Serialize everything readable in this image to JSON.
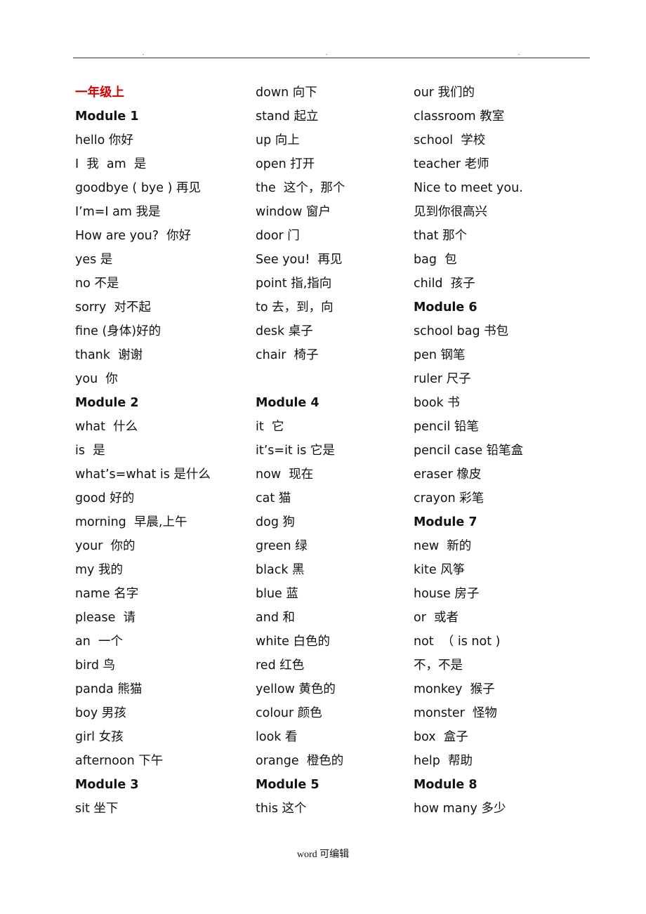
{
  "header": {
    "dots": [
      ".",
      ".",
      "."
    ]
  },
  "columns": [
    {
      "rows": [
        {
          "type": "title",
          "text": "一年级上"
        },
        {
          "type": "heading",
          "text": "Module 1"
        },
        {
          "type": "entry",
          "text": "hello 你好"
        },
        {
          "type": "entry",
          "text": "I  我  am  是"
        },
        {
          "type": "entry",
          "text": "goodbye ( bye ) 再见"
        },
        {
          "type": "entry",
          "text": "I’m=I am 我是"
        },
        {
          "type": "entry",
          "text": "How are you?  你好"
        },
        {
          "type": "entry",
          "text": "yes 是"
        },
        {
          "type": "entry",
          "text": "no 不是"
        },
        {
          "type": "entry",
          "text": "sorry  对不起"
        },
        {
          "type": "entry",
          "text": "fine (身体)好的"
        },
        {
          "type": "entry",
          "text": "thank  谢谢"
        },
        {
          "type": "entry",
          "text": "you  你"
        },
        {
          "type": "heading",
          "text": "Module 2"
        },
        {
          "type": "entry",
          "text": "what  什么"
        },
        {
          "type": "entry",
          "text": "is  是"
        },
        {
          "type": "entry",
          "text": "what’s=what is 是什么"
        },
        {
          "type": "entry",
          "text": "good 好的"
        },
        {
          "type": "entry",
          "text": "morning  早晨,上午"
        },
        {
          "type": "entry",
          "text": "your  你的"
        },
        {
          "type": "entry",
          "text": "my 我的"
        },
        {
          "type": "entry",
          "text": "name 名字"
        },
        {
          "type": "entry",
          "text": "please  请"
        },
        {
          "type": "entry",
          "text": "an  一个"
        },
        {
          "type": "entry",
          "text": "bird 鸟"
        },
        {
          "type": "entry",
          "text": "panda 熊猫"
        },
        {
          "type": "entry",
          "text": "boy 男孩"
        },
        {
          "type": "entry",
          "text": "girl 女孩"
        },
        {
          "type": "entry",
          "text": "afternoon 下午"
        },
        {
          "type": "heading",
          "text": "Module 3"
        },
        {
          "type": "entry",
          "text": "sit 坐下"
        }
      ]
    },
    {
      "rows": [
        {
          "type": "entry",
          "text": "down 向下"
        },
        {
          "type": "entry",
          "text": "stand 起立"
        },
        {
          "type": "entry",
          "text": "up 向上"
        },
        {
          "type": "entry",
          "text": "open 打开"
        },
        {
          "type": "entry",
          "text": "the  这个，那个"
        },
        {
          "type": "entry",
          "text": "window 窗户"
        },
        {
          "type": "entry",
          "text": "door 门"
        },
        {
          "type": "entry",
          "text": "See you!  再见"
        },
        {
          "type": "entry",
          "text": "point 指,指向"
        },
        {
          "type": "entry",
          "text": "to 去，到，向"
        },
        {
          "type": "entry",
          "text": "desk 桌子"
        },
        {
          "type": "entry",
          "text": "chair  椅子"
        },
        {
          "type": "blank",
          "text": ""
        },
        {
          "type": "heading",
          "text": "Module 4"
        },
        {
          "type": "entry",
          "text": "it  它"
        },
        {
          "type": "entry",
          "text": "it’s=it is 它是"
        },
        {
          "type": "entry",
          "text": "now  现在"
        },
        {
          "type": "entry",
          "text": "cat 猫"
        },
        {
          "type": "entry",
          "text": "dog 狗"
        },
        {
          "type": "entry",
          "text": "green 绿"
        },
        {
          "type": "entry",
          "text": "black 黑"
        },
        {
          "type": "entry",
          "text": "blue 蓝"
        },
        {
          "type": "entry",
          "text": "and 和"
        },
        {
          "type": "entry",
          "text": "white 白色的"
        },
        {
          "type": "entry",
          "text": "red 红色"
        },
        {
          "type": "entry",
          "text": "yellow 黄色的"
        },
        {
          "type": "entry",
          "text": "colour 颜色"
        },
        {
          "type": "entry",
          "text": "look 看"
        },
        {
          "type": "entry",
          "text": "orange  橙色的"
        },
        {
          "type": "heading",
          "text": "Module 5"
        },
        {
          "type": "entry",
          "text": "this 这个"
        }
      ]
    },
    {
      "rows": [
        {
          "type": "entry",
          "text": "our 我们的"
        },
        {
          "type": "entry",
          "text": "classroom 教室"
        },
        {
          "type": "entry",
          "text": "school  学校"
        },
        {
          "type": "entry",
          "text": "teacher 老师"
        },
        {
          "type": "entry",
          "text": "Nice to meet you."
        },
        {
          "type": "entry",
          "text": "见到你很高兴"
        },
        {
          "type": "entry",
          "text": "that 那个"
        },
        {
          "type": "entry",
          "text": "bag  包"
        },
        {
          "type": "entry",
          "text": "child  孩子"
        },
        {
          "type": "heading",
          "text": "Module 6"
        },
        {
          "type": "entry",
          "text": "school bag 书包"
        },
        {
          "type": "entry",
          "text": "pen 钢笔"
        },
        {
          "type": "entry",
          "text": "ruler 尺子"
        },
        {
          "type": "entry",
          "text": "book 书"
        },
        {
          "type": "entry",
          "text": "pencil 铅笔"
        },
        {
          "type": "entry",
          "text": "pencil case 铅笔盒"
        },
        {
          "type": "entry",
          "text": "eraser 橡皮"
        },
        {
          "type": "entry",
          "text": "crayon 彩笔"
        },
        {
          "type": "heading",
          "text": "Module 7"
        },
        {
          "type": "entry",
          "text": "new  新的"
        },
        {
          "type": "entry",
          "text": "kite 风筝"
        },
        {
          "type": "entry",
          "text": "house 房子"
        },
        {
          "type": "entry",
          "text": "or  或者"
        },
        {
          "type": "entry",
          "text": "not  （ is not )"
        },
        {
          "type": "entry",
          "text": "不，不是"
        },
        {
          "type": "entry",
          "text": "monkey  猴子"
        },
        {
          "type": "entry",
          "text": "monster  怪物"
        },
        {
          "type": "entry",
          "text": "box  盒子"
        },
        {
          "type": "entry",
          "text": "help  帮助"
        },
        {
          "type": "heading",
          "text": "Module 8"
        },
        {
          "type": "entry",
          "text": "how many 多少"
        }
      ]
    }
  ],
  "footer": {
    "text": "word 可编辑"
  }
}
